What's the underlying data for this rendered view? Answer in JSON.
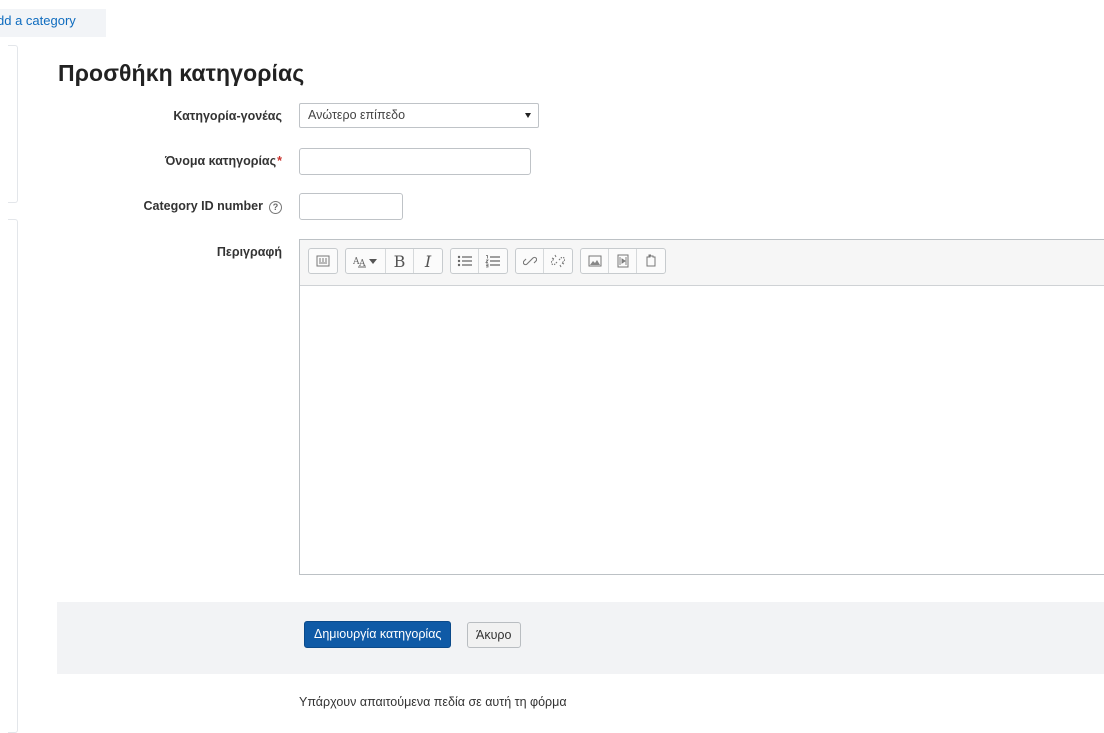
{
  "breadcrumb": {
    "label": "dd a category"
  },
  "page": {
    "title": "Προσθήκη κατηγορίας"
  },
  "form": {
    "parent_label": "Κατηγορία-γονέας",
    "parent_value": "Ανώτερο επίπεδο",
    "name_label": "Όνομα κατηγορίας",
    "required_mark": "*",
    "name_value": "",
    "idnumber_label": "Category ID number",
    "help_glyph": "?",
    "idnumber_value": "",
    "description_label": "Περιγραφή"
  },
  "toolbar": {
    "groups": [
      [
        {
          "name": "toolbar-toggle-icon"
        }
      ],
      [
        {
          "name": "text-style-icon"
        },
        {
          "name": "bold-icon",
          "glyph": "B"
        },
        {
          "name": "italic-icon",
          "glyph": "I"
        }
      ],
      [
        {
          "name": "unordered-list-icon"
        },
        {
          "name": "ordered-list-icon"
        }
      ],
      [
        {
          "name": "link-icon"
        },
        {
          "name": "unlink-icon"
        }
      ],
      [
        {
          "name": "image-icon"
        },
        {
          "name": "media-icon"
        },
        {
          "name": "manage-files-icon"
        }
      ]
    ]
  },
  "actions": {
    "submit_label": "Δημιουργία κατηγορίας",
    "cancel_label": "Άκυρο"
  },
  "footer": {
    "required_note": "Υπάρχουν απαιτούμενα πεδία σε αυτή τη φόρμα"
  },
  "colors": {
    "primary": "#0f5aa6",
    "link": "#0f6cbf",
    "required": "#c9312c",
    "actions_bg": "#f2f3f5"
  }
}
